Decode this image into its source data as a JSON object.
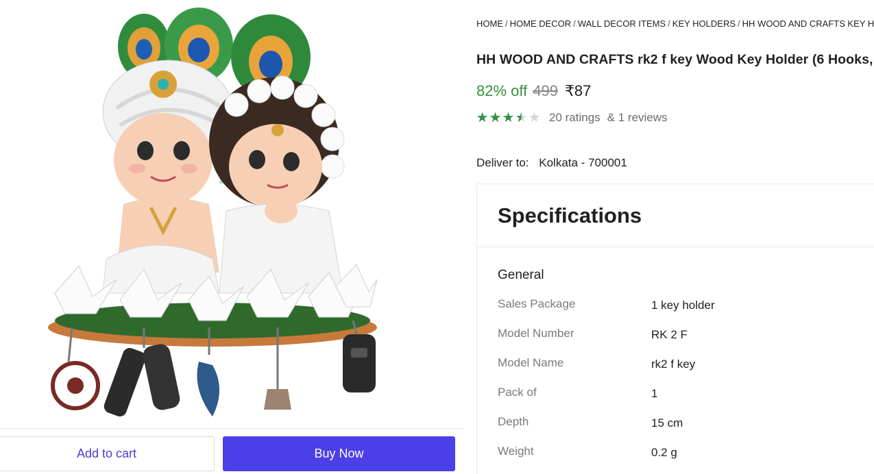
{
  "actions": {
    "add_to_cart": "Add to cart",
    "buy_now": "Buy Now"
  },
  "breadcrumb": [
    "HOME",
    "HOME DECOR",
    "WALL DECOR ITEMS",
    "KEY HOLDERS",
    "HH WOOD AND CRAFTS KEY HOLD"
  ],
  "product": {
    "title": "HH WOOD AND CRAFTS rk2 f key Wood Key Holder (6 Hooks,",
    "discount": "82% off",
    "mrp": "499",
    "price": "₹87",
    "rating_value": 3.5,
    "ratings": "20 ratings",
    "reviews": "& 1 reviews"
  },
  "delivery": {
    "label": "Deliver to:",
    "location": "Kolkata - 700001"
  },
  "specifications": {
    "title": "Specifications",
    "group": "General",
    "rows": [
      {
        "key": "Sales Package",
        "value": "1 key holder"
      },
      {
        "key": "Model Number",
        "value": "RK 2 F"
      },
      {
        "key": "Model Name",
        "value": "rk2 f key"
      },
      {
        "key": "Pack of",
        "value": "1"
      },
      {
        "key": "Depth",
        "value": "15 cm"
      },
      {
        "key": "Weight",
        "value": "0.2 g"
      }
    ]
  },
  "colors": {
    "accent": "#4b3fe8",
    "discount_green": "#388e3c",
    "star_green": "#2e9144"
  }
}
